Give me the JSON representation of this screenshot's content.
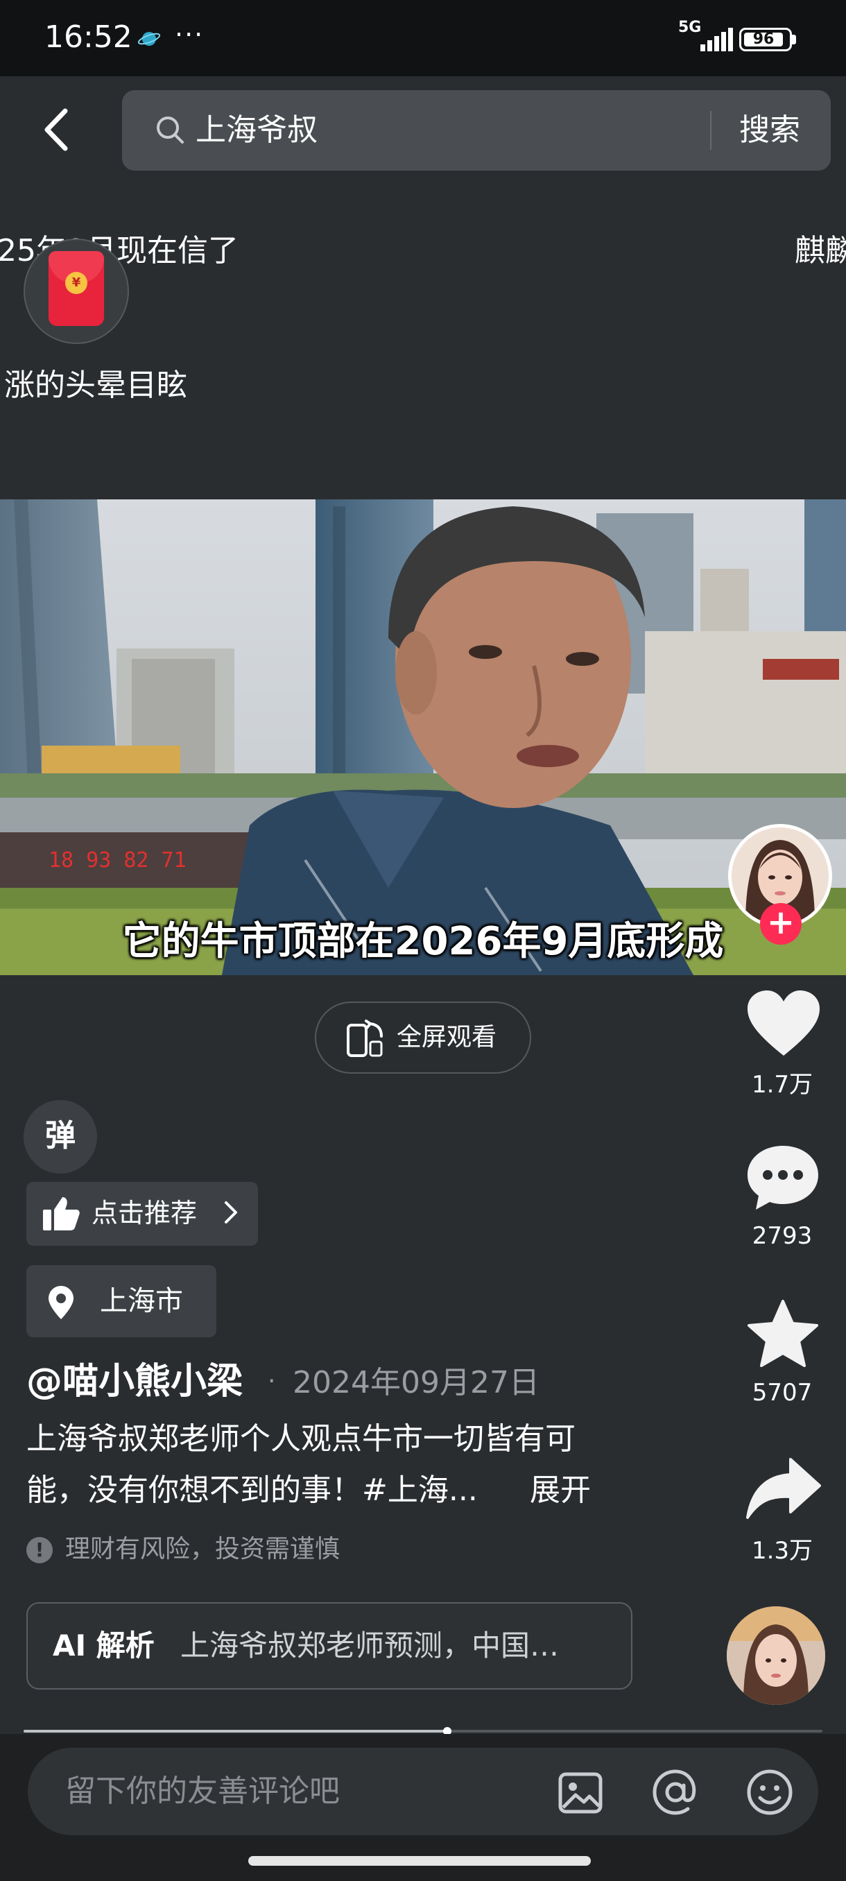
{
  "status_bar": {
    "time": "16:52",
    "more": "···",
    "network": "5G",
    "battery": "96"
  },
  "search": {
    "query": "上海爷叔",
    "button_label": "搜索"
  },
  "overlay_text": {
    "line1": "25年9月现在信了",
    "line1_right": "麒麟",
    "line2": "涨的头晕目眩",
    "redpacket_coin": "¥"
  },
  "video": {
    "subtitle": "它的牛市顶部在2026年9月底形成"
  },
  "actions": {
    "follow": "+",
    "like_count": "1.7万",
    "comment_count": "2793",
    "favorite_count": "5707",
    "share_count": "1.3万"
  },
  "fullscreen": {
    "label": "全屏观看"
  },
  "danmaku": {
    "label": "弹"
  },
  "recommend": {
    "label": "点击推荐"
  },
  "location": {
    "label": "上海市"
  },
  "post": {
    "author": "@喵小熊小梁",
    "separator": "·",
    "date": "2024年09月27日",
    "caption_line1": "上海爷叔郑老师个人观点牛市一切皆有可",
    "caption_line2": "能，没有你想不到的事！#上海...",
    "expand": "展开",
    "risk_icon": "!",
    "risk_notice": "理财有风险，投资需谨慎"
  },
  "ai": {
    "label": "AI 解析",
    "summary": "上海爷叔郑老师预测，中国…"
  },
  "progress": {
    "fraction": 0.53
  },
  "comment": {
    "placeholder": "留下你的友善评论吧"
  },
  "colors": {
    "background": "#2a2d30",
    "accent": "#fe2c55",
    "redpacket": "#e8233c"
  }
}
